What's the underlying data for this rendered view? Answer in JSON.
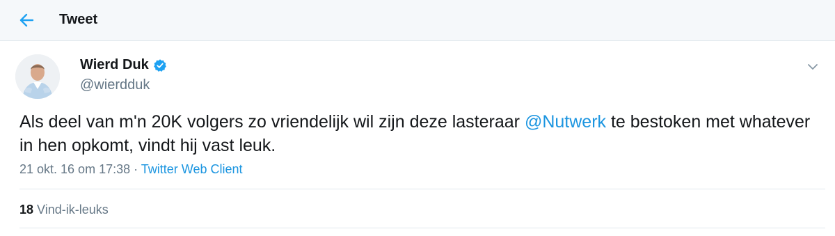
{
  "header": {
    "title": "Tweet",
    "back_icon": "arrow-left-icon"
  },
  "colors": {
    "accent": "#1da1f2",
    "link": "#1b95e0",
    "secondary_text": "#657786",
    "header_bg": "#f5f8fa"
  },
  "tweet": {
    "author_name": "Wierd Duk",
    "author_handle": "@wierdduk",
    "verified_icon": "verified-badge-icon",
    "text_before_mention": "Als deel van m'n 20K volgers zo vriendelijk wil zijn deze lasteraar ",
    "mention": "@Nutwerk",
    "text_after_mention": " te bestoken met whatever in hen opkomt, vindt hij vast leuk.",
    "timestamp": "21 okt. 16 om 17:38",
    "separator": " · ",
    "source": "Twitter Web Client",
    "likes_count": "18",
    "likes_label": "Vind-ik-leuks"
  }
}
